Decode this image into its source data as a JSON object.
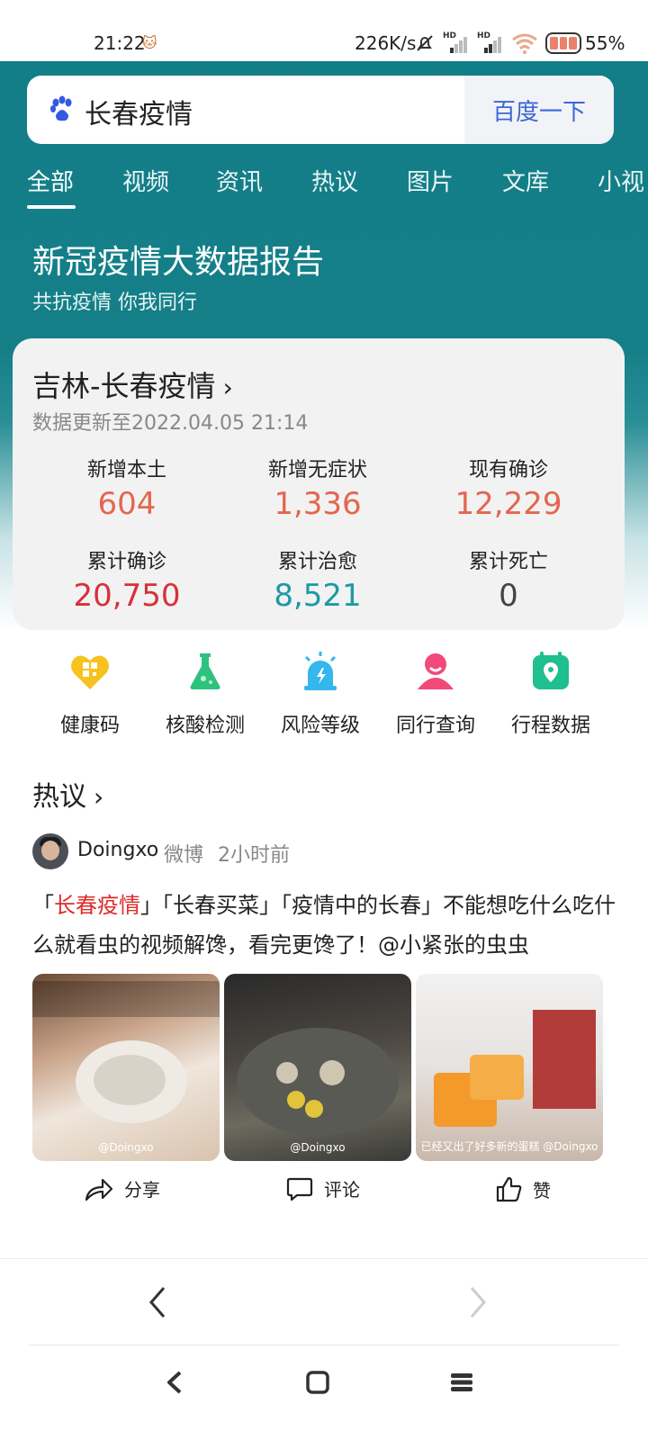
{
  "status_bar": {
    "time": "21:22",
    "net_speed": "226K/s",
    "battery_pct": "55%"
  },
  "search": {
    "query": "长春疫情",
    "button_label": "百度一下"
  },
  "tabs": [
    "全部",
    "视频",
    "资讯",
    "热议",
    "图片",
    "文库",
    "小视"
  ],
  "active_tab": "全部",
  "report": {
    "title": "新冠疫情大数据报告",
    "subtitle": "共抗疫情 你我同行"
  },
  "data_card": {
    "region": "吉林-长春疫情",
    "updated": "数据更新至2022.04.05 21:14",
    "stats": [
      {
        "label": "新增本土",
        "value": "604",
        "color": "#e4664f"
      },
      {
        "label": "新增无症状",
        "value": "1,336",
        "color": "#e4664f"
      },
      {
        "label": "现有确诊",
        "value": "12,229",
        "color": "#e4664f"
      },
      {
        "label": "累计确诊",
        "value": "20,750",
        "color": "#d8303a"
      },
      {
        "label": "累计治愈",
        "value": "8,521",
        "color": "#1c9aa3"
      },
      {
        "label": "累计死亡",
        "value": "0",
        "color": "#444444"
      }
    ]
  },
  "shortcuts": [
    {
      "label": "健康码",
      "icon": "health-code-icon"
    },
    {
      "label": "核酸检测",
      "icon": "flask-icon"
    },
    {
      "label": "风险等级",
      "icon": "alarm-light-icon"
    },
    {
      "label": "同行查询",
      "icon": "person-icon"
    },
    {
      "label": "行程数据",
      "icon": "location-icon"
    }
  ],
  "hot": {
    "section_title": "热议",
    "post": {
      "user": "Doingxo",
      "source": "微博",
      "time": "2小时前",
      "text_hl": "长春疫情",
      "text_1": "「",
      "text_2": "」「长春买菜」「疫情中的长春」不能想吃什么吃什么就看虫的视频解馋，看完更馋了！@小紧张的虫虫",
      "thumbs": [
        {
          "caption": "@Doingxo"
        },
        {
          "caption": "@Doingxo"
        },
        {
          "caption": "已经又出了好多新的蛋糕 @Doingxo"
        }
      ],
      "actions": {
        "share": "分享",
        "comment": "评论",
        "like": "赞"
      }
    }
  }
}
